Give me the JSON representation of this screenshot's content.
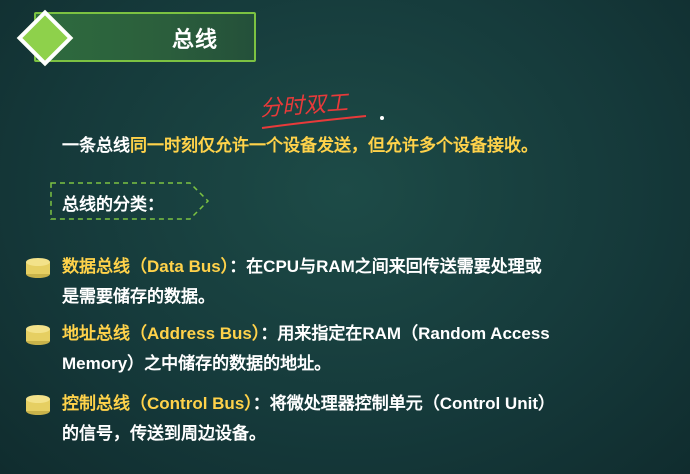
{
  "title": "总线",
  "annotation": "分时双工",
  "intro": {
    "lead": "一条总线",
    "rest": "同一时刻仅允许一个设备发送，但允许多个设备接收。"
  },
  "classification_label": "总线的分类：",
  "items": [
    {
      "name": "数据总线（Data Bus）",
      "desc_line1": "：在CPU与RAM之间来回传送需要处理或",
      "desc_line2": "是需要储存的数据。"
    },
    {
      "name": "地址总线（Address Bus）",
      "desc_line1": "：用来指定在RAM（Random Access",
      "desc_line2": "Memory）之中储存的数据的地址。"
    },
    {
      "name": "控制总线（Control Bus）",
      "desc_line1": "：将微处理器控制单元（Control Unit）",
      "desc_line2": "的信号，传送到周边设备。"
    }
  ],
  "colors": {
    "background": "#15393a",
    "accent_green": "#8ed14b",
    "highlight_yellow": "#ffd24a",
    "annotation_red": "#e83a3a"
  },
  "icons": [
    "diamond-bullet-icon",
    "database-icon"
  ]
}
